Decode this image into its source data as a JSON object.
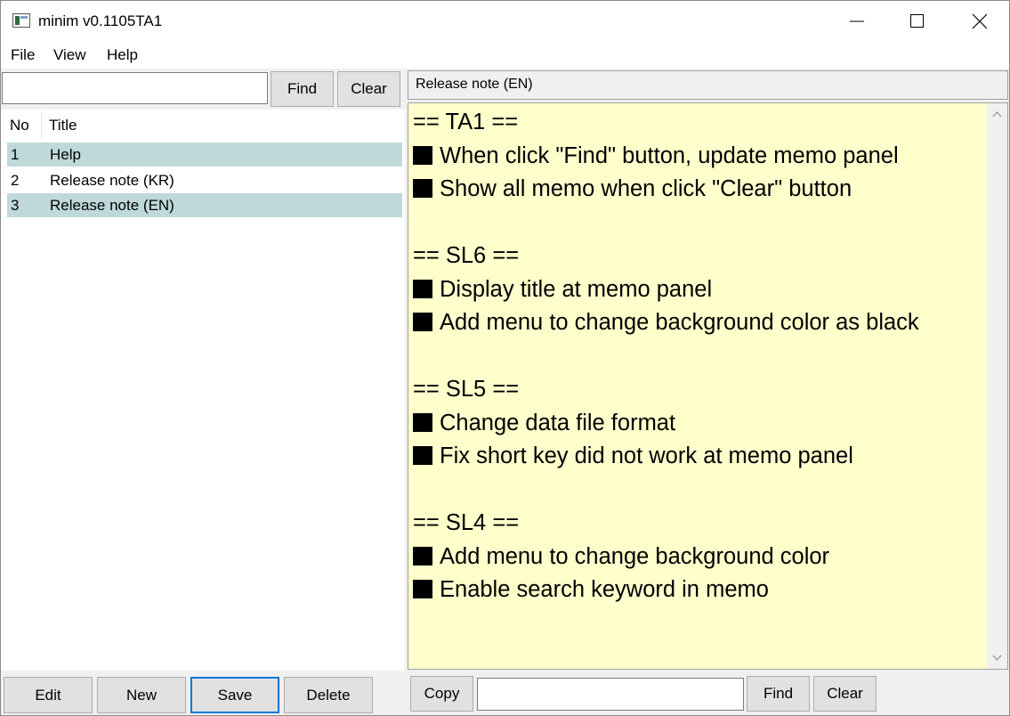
{
  "window": {
    "title": "minim v0.1105TA1"
  },
  "menu": [
    "File",
    "View",
    "Help"
  ],
  "left_panel": {
    "search": {
      "value": "",
      "placeholder": ""
    },
    "find_label": "Find",
    "clear_label": "Clear",
    "columns": {
      "no": "No",
      "title": "Title"
    },
    "rows": [
      {
        "no": "1",
        "title": "Help",
        "highlighted": true
      },
      {
        "no": "2",
        "title": "Release note (KR)",
        "highlighted": false
      },
      {
        "no": "3",
        "title": "Release note (EN)",
        "highlighted": true
      }
    ],
    "buttons": {
      "edit": "Edit",
      "new": "New",
      "save": "Save",
      "delete": "Delete"
    }
  },
  "memo_panel": {
    "title": "Release note (EN)",
    "background_color": "#ffffcc",
    "lines": [
      {
        "bullet": false,
        "text": "== TA1 =="
      },
      {
        "bullet": true,
        "text": "When click \"Find\" button, update memo panel"
      },
      {
        "bullet": true,
        "text": "Show all memo when click \"Clear\" button"
      },
      {
        "bullet": false,
        "text": ""
      },
      {
        "bullet": false,
        "text": "== SL6 =="
      },
      {
        "bullet": true,
        "text": "Display title at memo panel"
      },
      {
        "bullet": true,
        "text": "Add menu to change background color as black"
      },
      {
        "bullet": false,
        "text": ""
      },
      {
        "bullet": false,
        "text": "== SL5 =="
      },
      {
        "bullet": true,
        "text": "Change data file format"
      },
      {
        "bullet": true,
        "text": "Fix short key did not work at memo panel"
      },
      {
        "bullet": false,
        "text": ""
      },
      {
        "bullet": false,
        "text": "== SL4 =="
      },
      {
        "bullet": true,
        "text": "Add menu to change background color"
      },
      {
        "bullet": true,
        "text": "Enable search keyword in memo"
      }
    ],
    "bottom": {
      "copy_label": "Copy",
      "find_value": "",
      "find_label": "Find",
      "clear_label": "Clear"
    }
  },
  "colors": {
    "selected_row": "#bfd9da",
    "focus_border": "#0078d7"
  },
  "icons": [
    "app-icon",
    "minimize-icon",
    "maximize-icon",
    "close-icon",
    "scroll-up-arrow-icon",
    "scroll-down-arrow-icon",
    "black-square-bullet-icon"
  ]
}
